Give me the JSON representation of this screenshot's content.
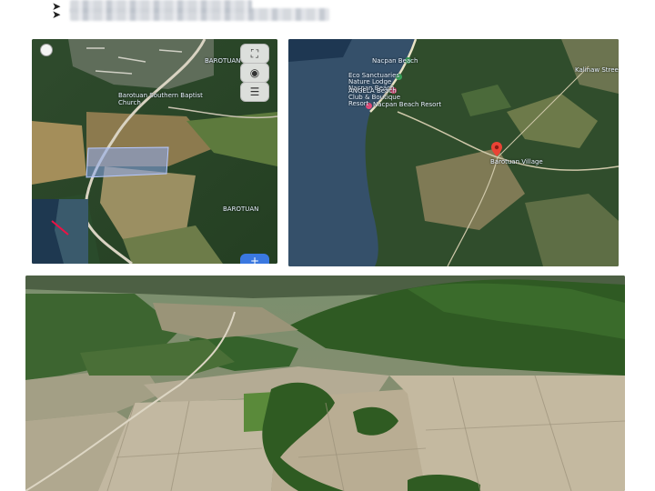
{
  "bullets": [
    {
      "icon": "arrow-bullet-icon"
    },
    {
      "icon": "arrow-bullet-icon"
    }
  ],
  "map1": {
    "labels": {
      "barotuan_top": "BAROTUAN",
      "church": "Barotuan Southern Baptist Church",
      "barotuan_bottom": "BAROTUAN"
    },
    "controls": [
      "expand-icon",
      "eye-icon",
      "layers-icon"
    ],
    "compass": "compass-icon",
    "add_button": "+"
  },
  "map2": {
    "labels": {
      "nacpan": "Nacpan Beach",
      "eco": "Eco Sanctuaries Nature Lodge Nacpan Beach",
      "angela": "ANGELA Beach Club & Boutique Resort",
      "angel": "Nacpan Beach Resort",
      "kalinaw": "Kalinaw Streets Cafe",
      "pin_label": "Barotuan Village"
    },
    "pin_color": "#ea4335",
    "poi_green": "#3aa35b",
    "poi_pink": "#e34a7a"
  },
  "aerial": {}
}
